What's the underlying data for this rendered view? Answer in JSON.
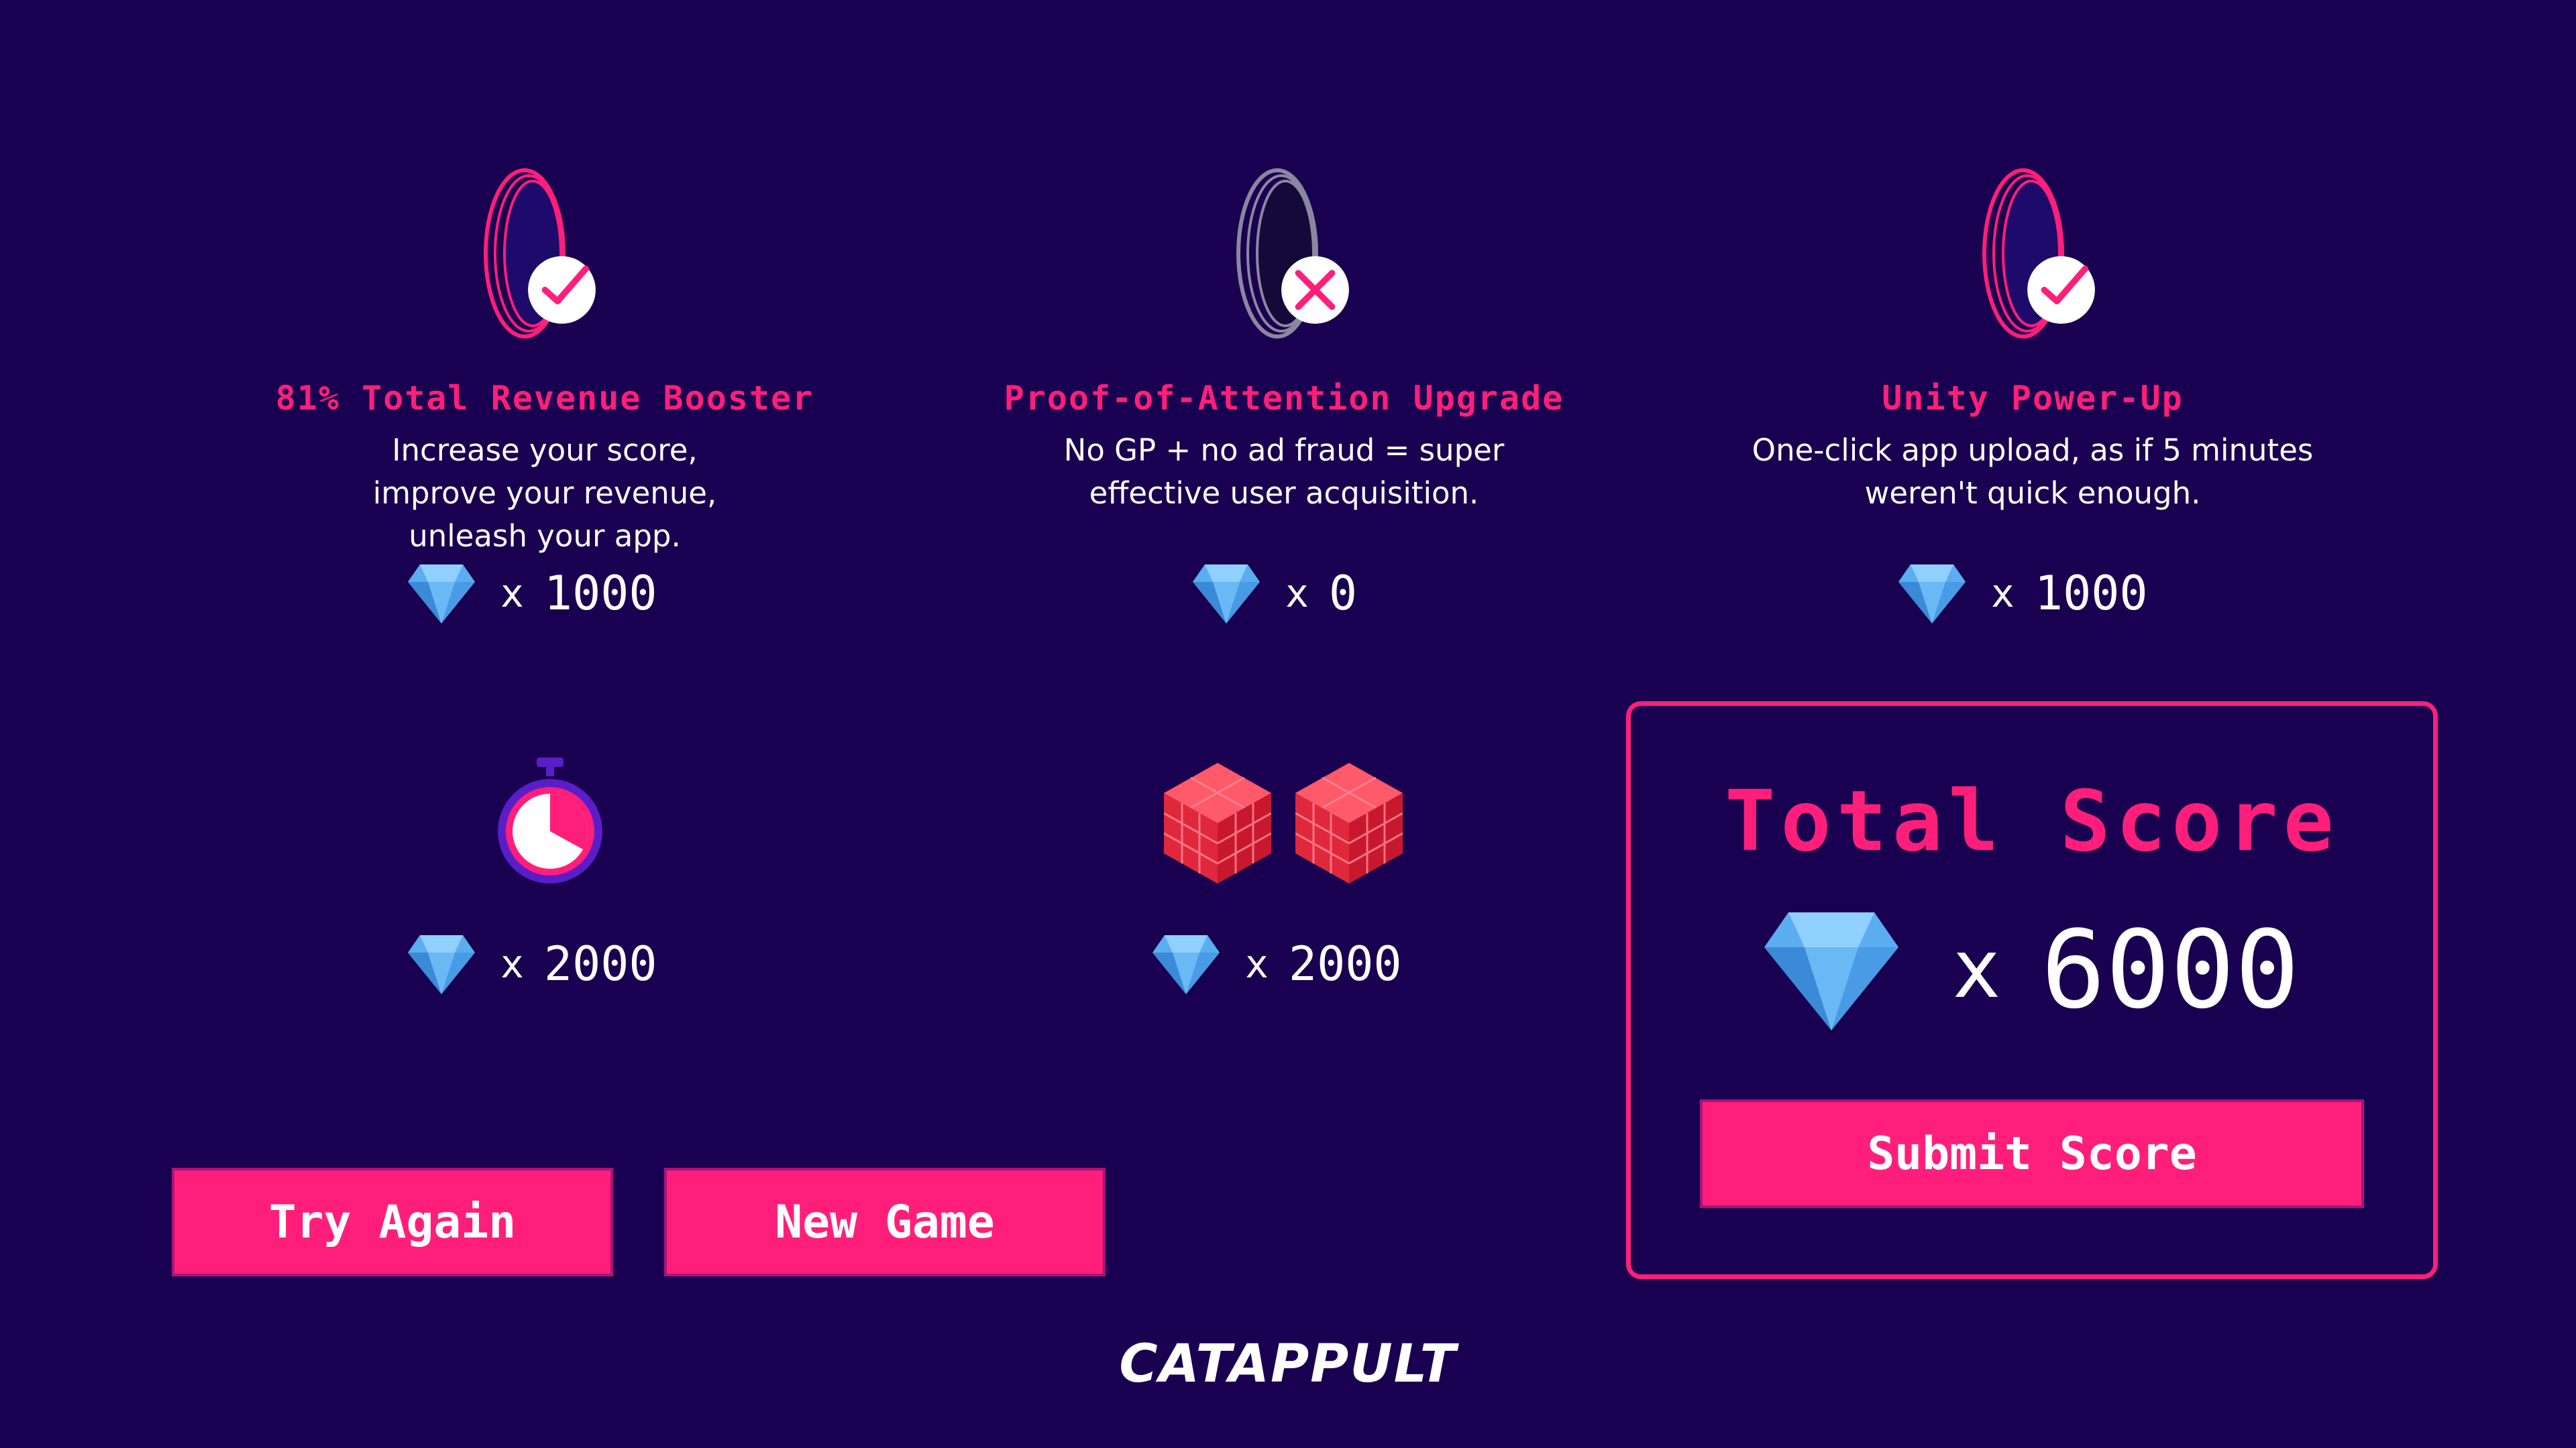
{
  "boosters": [
    {
      "title": "81% Total Revenue Booster",
      "description": "Increase your score, improve your revenue, unleash your app.",
      "status_icon": "checkmark-icon",
      "multiplier": "x",
      "value": "1000"
    },
    {
      "title": "Proof-of-Attention Upgrade",
      "description": "No GP + no ad fraud = super effective user acquisition.",
      "status_icon": "cross-icon",
      "multiplier": "x",
      "value": "0"
    },
    {
      "title": "Unity Power-Up",
      "description": "One-click app upload, as if 5 minutes weren't quick enough.",
      "status_icon": "checkmark-icon",
      "multiplier": "x",
      "value": "1000"
    }
  ],
  "bonuses": [
    {
      "icon": "stopwatch-icon",
      "multiplier": "x",
      "value": "2000"
    },
    {
      "icon": "cubes-icon",
      "multiplier": "x",
      "value": "2000"
    }
  ],
  "total": {
    "title": "Total Score",
    "multiplier": "x",
    "value": "6000",
    "submit_label": "Submit Score"
  },
  "buttons": {
    "try_again": "Try Again",
    "new_game": "New Game"
  },
  "logo": "CATAPPULT",
  "colors": {
    "background": "#1a0050",
    "accent": "#ff1f7a",
    "gem": "#5aaef0"
  }
}
